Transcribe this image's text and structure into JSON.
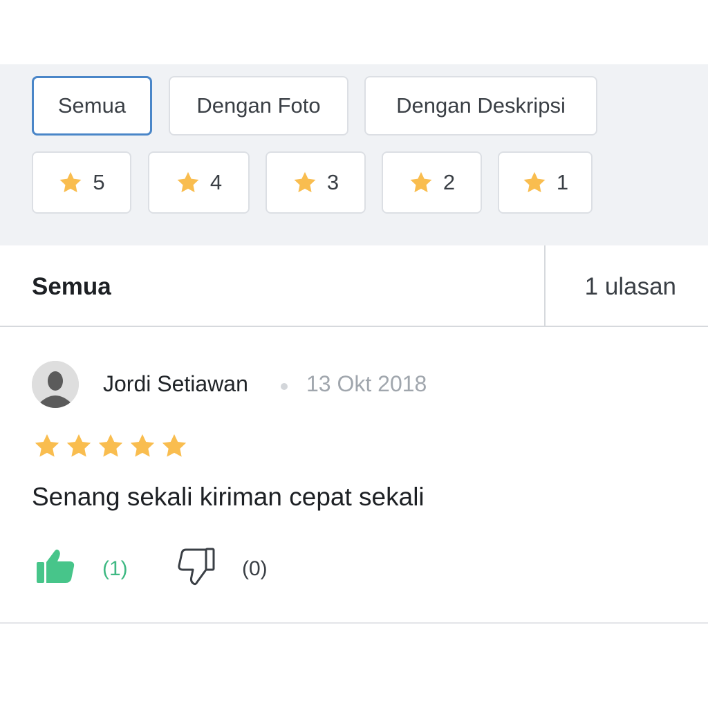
{
  "filters": {
    "type_chips": [
      {
        "label": "Semua",
        "selected": true
      },
      {
        "label": "Dengan Foto",
        "selected": false
      },
      {
        "label": "Dengan Deskripsi",
        "selected": false
      }
    ],
    "star_chips": [
      {
        "label": "5",
        "icon": "star-icon"
      },
      {
        "label": "4",
        "icon": "star-icon"
      },
      {
        "label": "3",
        "icon": "star-icon"
      },
      {
        "label": "2",
        "icon": "star-icon"
      },
      {
        "label": "1",
        "icon": "star-icon"
      }
    ]
  },
  "summary": {
    "label": "Semua",
    "count": "1 ulasan"
  },
  "review": {
    "reviewer": "Jordi Setiawan",
    "date": "13 Okt 2018",
    "rating": 5,
    "text": "Senang sekali kiriman cepat sekali",
    "like_count": "(1)",
    "dislike_count": "(0)"
  },
  "colors": {
    "star": "#f9bd4f",
    "accent_border": "#4a86c8",
    "like": "#3fb983",
    "panel_bg": "#f0f2f5"
  }
}
